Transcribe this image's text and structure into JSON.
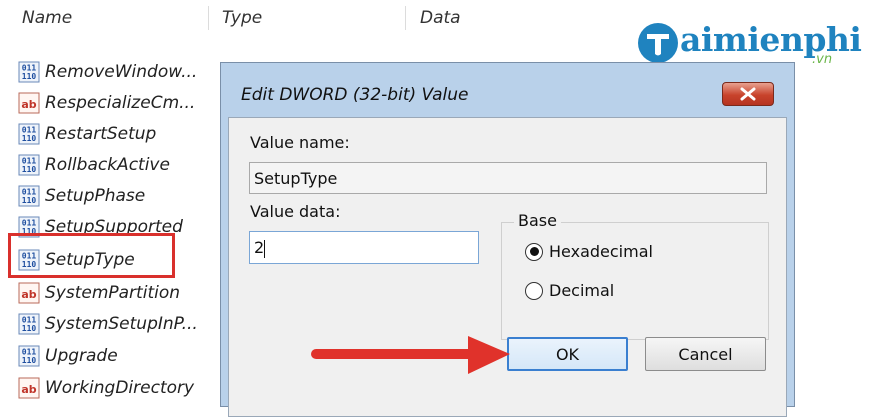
{
  "columns": {
    "name": "Name",
    "type": "Type",
    "data": "Data"
  },
  "values": [
    {
      "label": "RemoveWindow...",
      "icon": "dword-icon"
    },
    {
      "label": "RespecializeCm...",
      "icon": "string-icon"
    },
    {
      "label": "RestartSetup",
      "icon": "dword-icon"
    },
    {
      "label": "RollbackActive",
      "icon": "dword-icon"
    },
    {
      "label": "SetupPhase",
      "icon": "dword-icon"
    },
    {
      "label": "SetupSupported",
      "icon": "dword-icon"
    },
    {
      "label": "SetupType",
      "icon": "dword-icon"
    },
    {
      "label": "SystemPartition",
      "icon": "string-icon"
    },
    {
      "label": "SystemSetupInP...",
      "icon": "dword-icon"
    },
    {
      "label": "Upgrade",
      "icon": "dword-icon"
    },
    {
      "label": "WorkingDirectory",
      "icon": "string-icon"
    }
  ],
  "watermark": {
    "main": "aimienphi",
    "suffix": ".vn",
    "icon": "t-logo-icon"
  },
  "dialog": {
    "title": "Edit DWORD (32-bit) Value",
    "value_name_label": "Value name:",
    "value_name": "SetupType",
    "value_data_label": "Value data:",
    "value_data": "2",
    "base_label": "Base",
    "hex_label": "Hexadecimal",
    "dec_label": "Decimal",
    "selected_base": "Hexadecimal",
    "ok_label": "OK",
    "cancel_label": "Cancel"
  },
  "colors": {
    "highlight": "#d9302c",
    "arrow": "#e0322b",
    "dialog_frame": "#b9d1ea",
    "close": "#c8432c"
  }
}
